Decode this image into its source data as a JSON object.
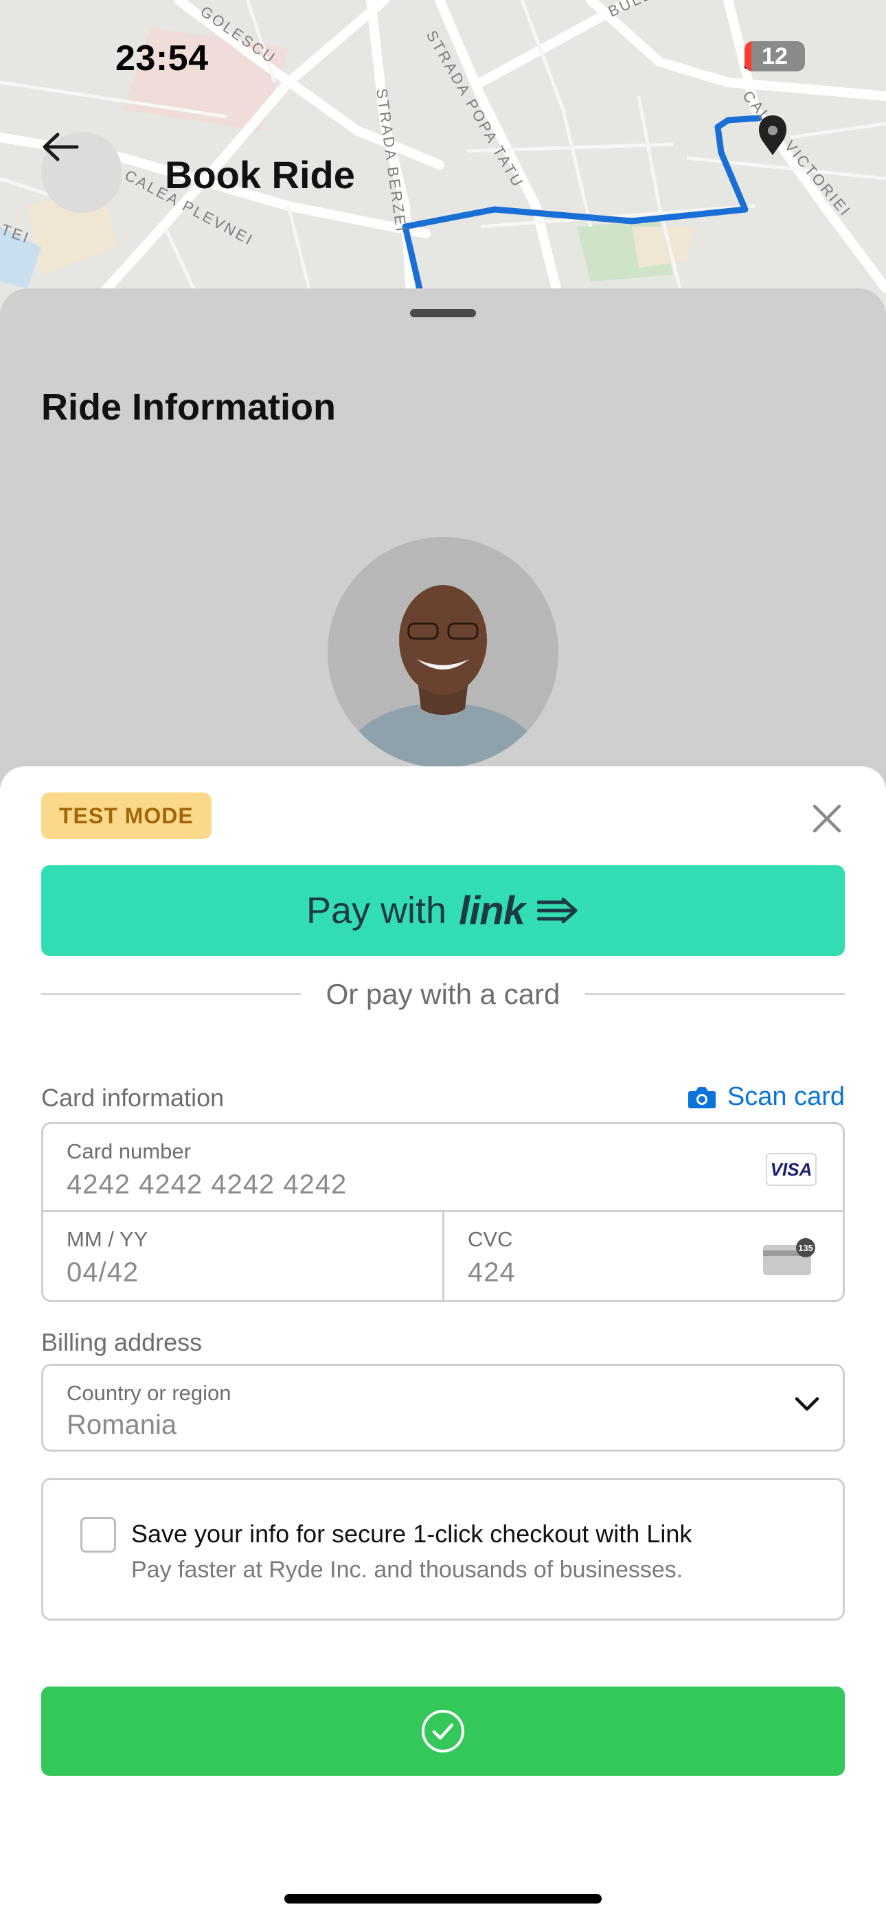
{
  "status_bar": {
    "time": "23:54",
    "battery_level": "12",
    "icons": [
      "signal-icon",
      "wifi-icon",
      "battery-icon"
    ]
  },
  "header": {
    "title": "Book Ride",
    "back_icon": "arrow-left-icon"
  },
  "map": {
    "street_labels": [
      "GOLESCU",
      "STRADA POPA TATU",
      "STRADA BERZEI",
      "CALEA PLEVNEI",
      "CALEA VICTORIEI",
      "BULE",
      "TEI"
    ]
  },
  "ride_sheet": {
    "title": "Ride Information"
  },
  "payment_sheet": {
    "test_mode_label": "TEST MODE",
    "close_icon": "close-icon",
    "link_button": {
      "pay_with": "Pay with",
      "brand": "link",
      "arrow_icon": "link-arrow-icon"
    },
    "divider_text": "Or pay with a card",
    "card_info_label": "Card information",
    "scan_card_label": "Scan card",
    "card_number": {
      "caption": "Card number",
      "value": "4242 4242 4242 4242",
      "brand": "VISA"
    },
    "expiry": {
      "caption": "MM / YY",
      "value": "04/42"
    },
    "cvc": {
      "caption": "CVC",
      "value": "424",
      "icon_badge": "135"
    },
    "billing_label": "Billing address",
    "country": {
      "caption": "Country or region",
      "value": "Romania"
    },
    "save_info": {
      "title": "Save your info for secure 1-click checkout with Link",
      "subtitle": "Pay faster at Ryde Inc. and thousands of businesses.",
      "checked": false
    },
    "pay_button_icon": "checkmark-circle-icon"
  },
  "colors": {
    "link_green": "#33ddb3",
    "pay_green": "#34c759",
    "accent_blue": "#0a74da",
    "route_blue": "#1a6fd6",
    "test_badge_bg": "#fcd98a"
  }
}
